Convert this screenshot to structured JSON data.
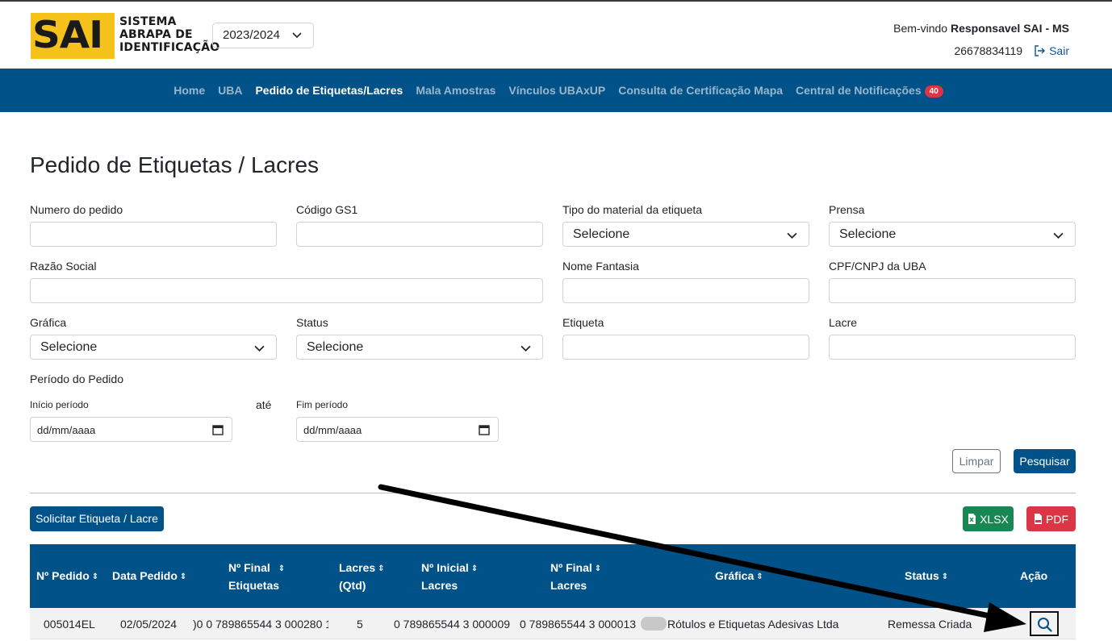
{
  "header": {
    "logo_mark": "SAI",
    "logo_lines": [
      "SISTEMA",
      "ABRAPA DE",
      "IDENTIFICAÇÃO"
    ],
    "season": "2023/2024",
    "welcome_prefix": "Bem-vindo",
    "welcome_user": "Responsavel SAI - MS",
    "user_id": "26678834119",
    "logout_label": "Sair"
  },
  "nav": {
    "items": [
      {
        "label": "Home"
      },
      {
        "label": "UBA"
      },
      {
        "label": "Pedido de Etiquetas/Lacres"
      },
      {
        "label": "Mala Amostras"
      },
      {
        "label": "Vínculos UBAxUP"
      },
      {
        "label": "Consulta de Certificação Mapa"
      },
      {
        "label": "Central de Notificações"
      }
    ],
    "notification_count": "40"
  },
  "page": {
    "title": "Pedido de Etiquetas / Lacres"
  },
  "filters": {
    "numero_pedido": "Numero do pedido",
    "codigo_gs1": "Código GS1",
    "tipo_material": "Tipo do material da etiqueta",
    "prensa": "Prensa",
    "razao_social": "Razão Social",
    "nome_fantasia": "Nome Fantasia",
    "cpf_cnpj": "CPF/CNPJ da UBA",
    "grafica": "Gráfica",
    "status": "Status",
    "etiqueta": "Etiqueta",
    "lacre": "Lacre",
    "periodo": "Período do Pedido",
    "inicio": "Início período",
    "ate": "até",
    "fim": "Fim período",
    "select_placeholder": "Selecione",
    "date_placeholder": "dd/mm/aaaa"
  },
  "buttons": {
    "limpar": "Limpar",
    "pesquisar": "Pesquisar",
    "solicitar": "Solicitar Etiqueta / Lacre",
    "xlsx": "XLSX",
    "pdf": "PDF"
  },
  "table": {
    "columns": {
      "pedido": "Nº Pedido",
      "data": "Data Pedido",
      "final_etq_1": "Nº Final",
      "final_etq_2": "Etiquetas",
      "lacres_1": "Lacres",
      "lacres_2": "(Qtd)",
      "ini_lacres_1": "Nº Inicial",
      "ini_lacres_2": "Lacres",
      "fim_lacres_1": "Nº Final",
      "fim_lacres_2": "Lacres",
      "grafica": "Gráfica",
      "status": "Status",
      "acao": "Ação"
    },
    "rows": [
      {
        "pedido": "005014EL",
        "data": "02/05/2024",
        "final_etiquetas": ")0 0 789865544 3 000280 1",
        "lacres_qtd": "5",
        "inicial_lacres": "0 789865544 3 000009",
        "final_lacres": "0 789865544 3 000013",
        "grafica": "Rótulos e Etiquetas Adesivas Ltda",
        "status": "Remessa Criada"
      }
    ]
  },
  "colors": {
    "brand_blue": "#005289",
    "logo_yellow": "#f4c21a",
    "badge_red": "#dc3545",
    "xlsx_green": "#198754",
    "pdf_red": "#dc3545"
  }
}
